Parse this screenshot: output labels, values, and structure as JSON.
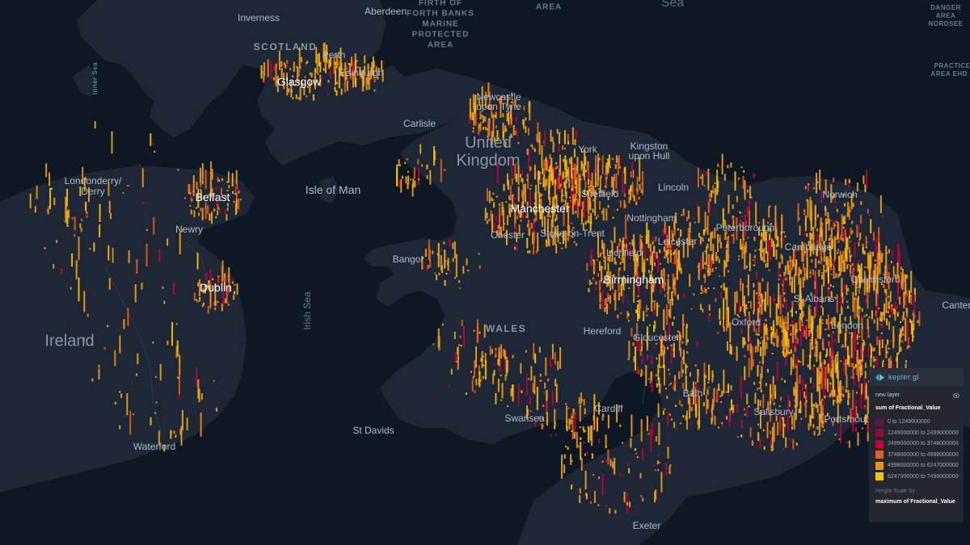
{
  "labels": {
    "cities_major": [
      "Glasgow",
      "Belfast",
      "Dublin",
      "Manchester",
      "Birmingham"
    ],
    "cities": [
      "Inverness",
      "Aberdeen",
      "Perth",
      "Edinburgh",
      "Newcastle upon Tyne",
      "Carlisle",
      "York",
      "Kingston upon Hull",
      "Londonderry/ Derry",
      "Newry",
      "Sheffield",
      "Lincoln",
      "Nottingham",
      "Norwich",
      "Chester",
      "Stoke-on-Trent",
      "Leicester",
      "Peterborough",
      "Lichfield",
      "Bangor",
      "Hereford",
      "Gloucester",
      "Oxford",
      "St Albans",
      "Chelmsford",
      "Canterbury",
      "Cardiff",
      "Swansea",
      "Bath",
      "Salisbury",
      "St Davids",
      "Waterford",
      "Exeter",
      "Portsmouth",
      "Cambridge",
      "London"
    ],
    "countries": [
      "United Kingdom",
      "Ireland"
    ],
    "regions": [
      "SCOTLAND",
      "WALES"
    ],
    "islands": [
      "Isle of Man"
    ],
    "waters": [
      "FIRTH OF FORTH BANKS MARINE PROTECTED AREA",
      "AREA",
      "DANGER AREA NORDSEE",
      "PRACTICE AREA EHD 4"
    ],
    "seas": [
      "Sea",
      "Irish Sea",
      "Inner Sea"
    ]
  },
  "legend": {
    "brand": "kepler.gl",
    "layer_name": "new layer",
    "color_field": "sum of Fractional_Value",
    "bins": [
      {
        "label": "0 to 1249000000",
        "color": "#5a1846"
      },
      {
        "label": "1249000000 to 2499000000",
        "color": "#900c3f"
      },
      {
        "label": "2499000000 to 3748000000",
        "color": "#c70039"
      },
      {
        "label": "3748000000 to 4998000000",
        "color": "#e3611c"
      },
      {
        "label": "4998000000 to 6247000000",
        "color": "#f1920e"
      },
      {
        "label": "6247000000 to 7496000000",
        "color": "#ffc300"
      }
    ],
    "height_label": "Height Scale by",
    "height_field": "maximum of Fractional_Value"
  },
  "colors": {
    "water": "#0e1724",
    "land": "#1d2736",
    "bar_main": "#f2a51a",
    "bar_hot": "#ffc300"
  }
}
